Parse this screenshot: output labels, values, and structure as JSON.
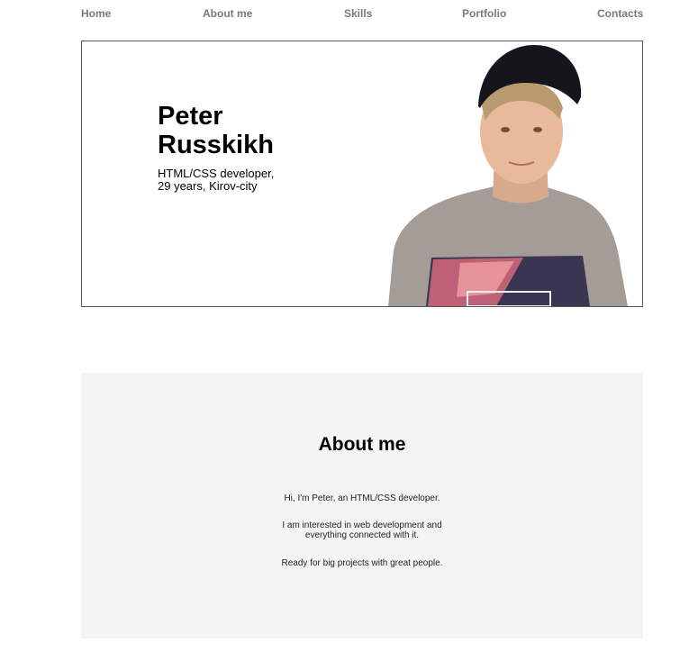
{
  "nav": {
    "items": [
      "Home",
      "About me",
      "Skills",
      "Portfolio",
      "Contacts"
    ]
  },
  "hero": {
    "name_first": "Peter",
    "name_last": "Russkikh",
    "subtitle_line1": "HTML/CSS developer,",
    "subtitle_line2": "29 years, Kirov-city"
  },
  "about": {
    "title": "About me",
    "paragraphs": [
      "Hi, I'm Peter, an HTML/CSS developer.",
      "I am interested in web development and everything connected with it.",
      "Ready for big projects with great people."
    ]
  },
  "colors": {
    "nav_text": "#7a7a7a",
    "section_bg": "#f4f4f4",
    "border": "#5a5a5a"
  }
}
